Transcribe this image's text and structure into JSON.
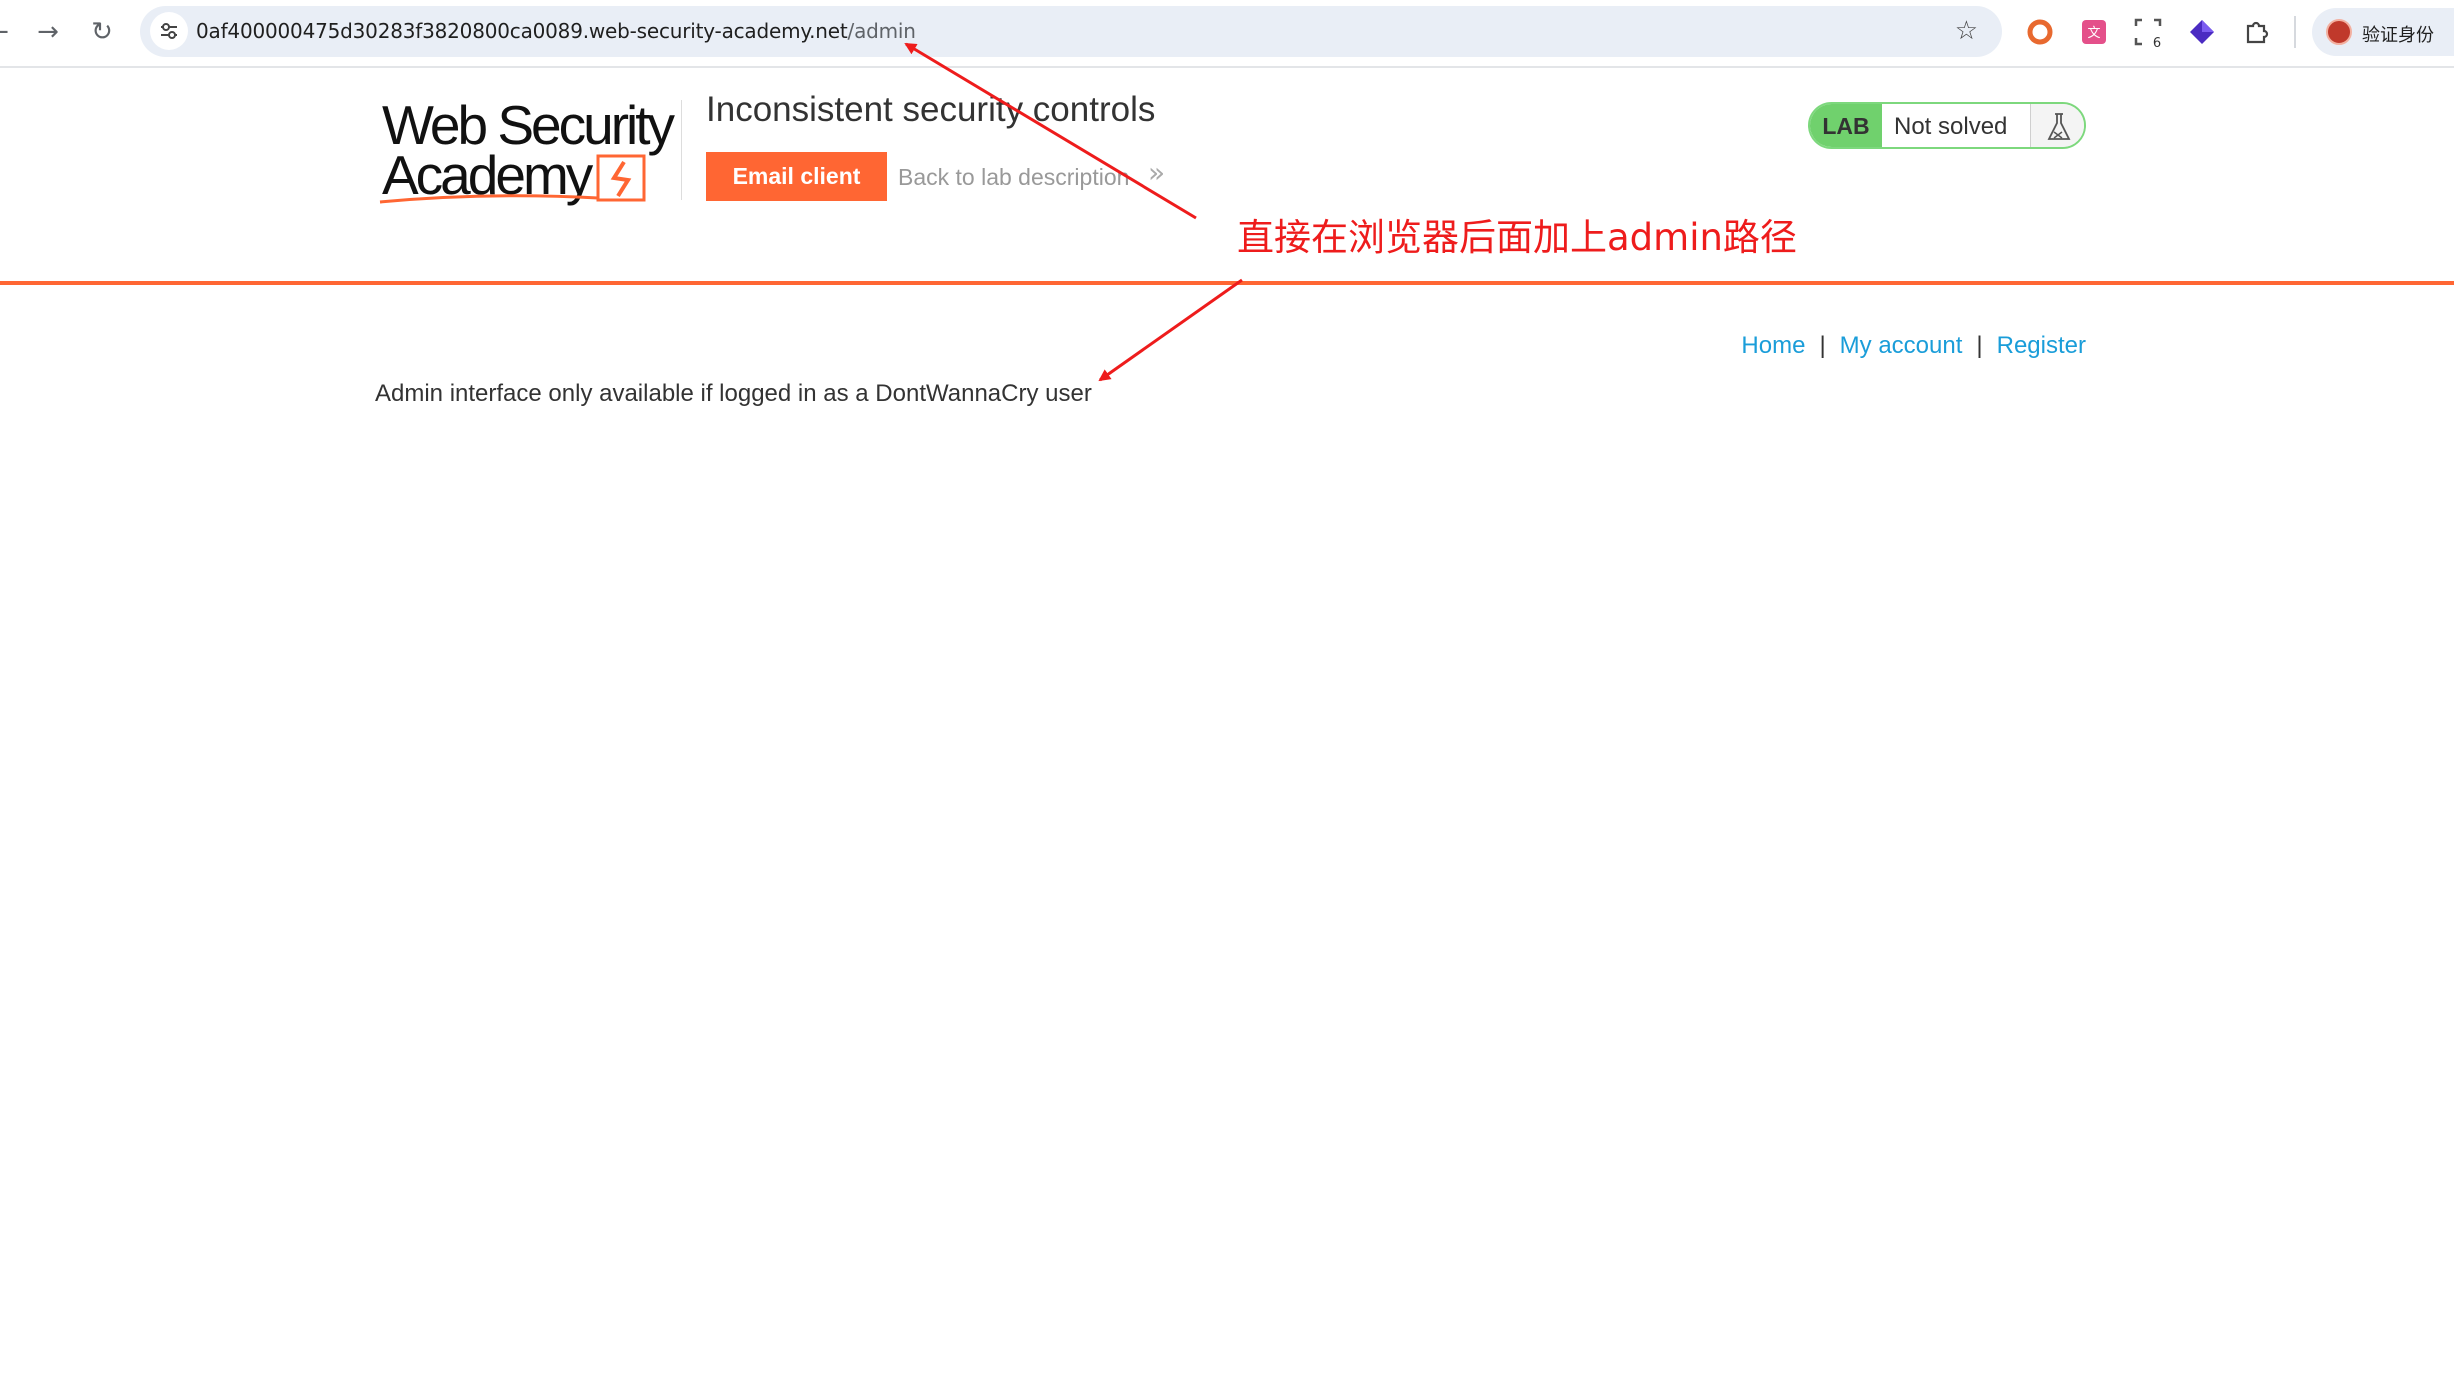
{
  "browser": {
    "url_host": "0af400000475d30283f3820800ca0089.web-security-academy.net",
    "url_path": "/admin",
    "profile_label": "验证身份",
    "nav": {
      "back_icon": "arrow-left-icon",
      "forward_icon": "arrow-right-icon",
      "reload_icon": "reload-icon"
    },
    "extensions": [
      "record-extension-icon",
      "translate-extension-icon",
      "screenshot-extension-icon",
      "diamond-extension-icon",
      "puzzle-extension-icon"
    ],
    "extension_badge": "6"
  },
  "lab": {
    "logo_line1": "Web Security",
    "logo_line2": "Academy",
    "title": "Inconsistent security controls",
    "email_client_label": "Email client",
    "back_link_label": "Back to lab description",
    "back_chevron": "»",
    "status_tag": "LAB",
    "status_text": "Not solved"
  },
  "page": {
    "nav": [
      {
        "label": "Home"
      },
      {
        "label": "My account"
      },
      {
        "label": "Register"
      }
    ],
    "nav_separator": "|",
    "admin_message": "Admin interface only available if logged in as a DontWannaCry user"
  },
  "annotation": {
    "text": "直接在浏览器后面加上admin路径"
  },
  "colors": {
    "accent_orange": "#ff6633",
    "lab_green": "#70d16d",
    "link_blue": "#1a9dd9",
    "annotation_red": "#ee1c1c",
    "omnibox_bg": "#e9eef6"
  }
}
